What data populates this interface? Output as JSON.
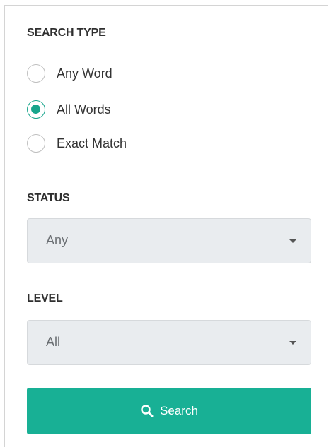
{
  "search_type": {
    "title": "SEARCH TYPE",
    "options": [
      {
        "label": "Any Word",
        "checked": false
      },
      {
        "label": "All Words",
        "checked": true
      },
      {
        "label": "Exact Match",
        "checked": false
      }
    ]
  },
  "status": {
    "title": "STATUS",
    "selected": "Any"
  },
  "level": {
    "title": "LEVEL",
    "selected": "All"
  },
  "search_button": {
    "label": "Search",
    "icon": "search-icon"
  },
  "colors": {
    "accent": "#18b095",
    "radio_checked": "#17a58c",
    "select_bg": "#e9ecef"
  }
}
